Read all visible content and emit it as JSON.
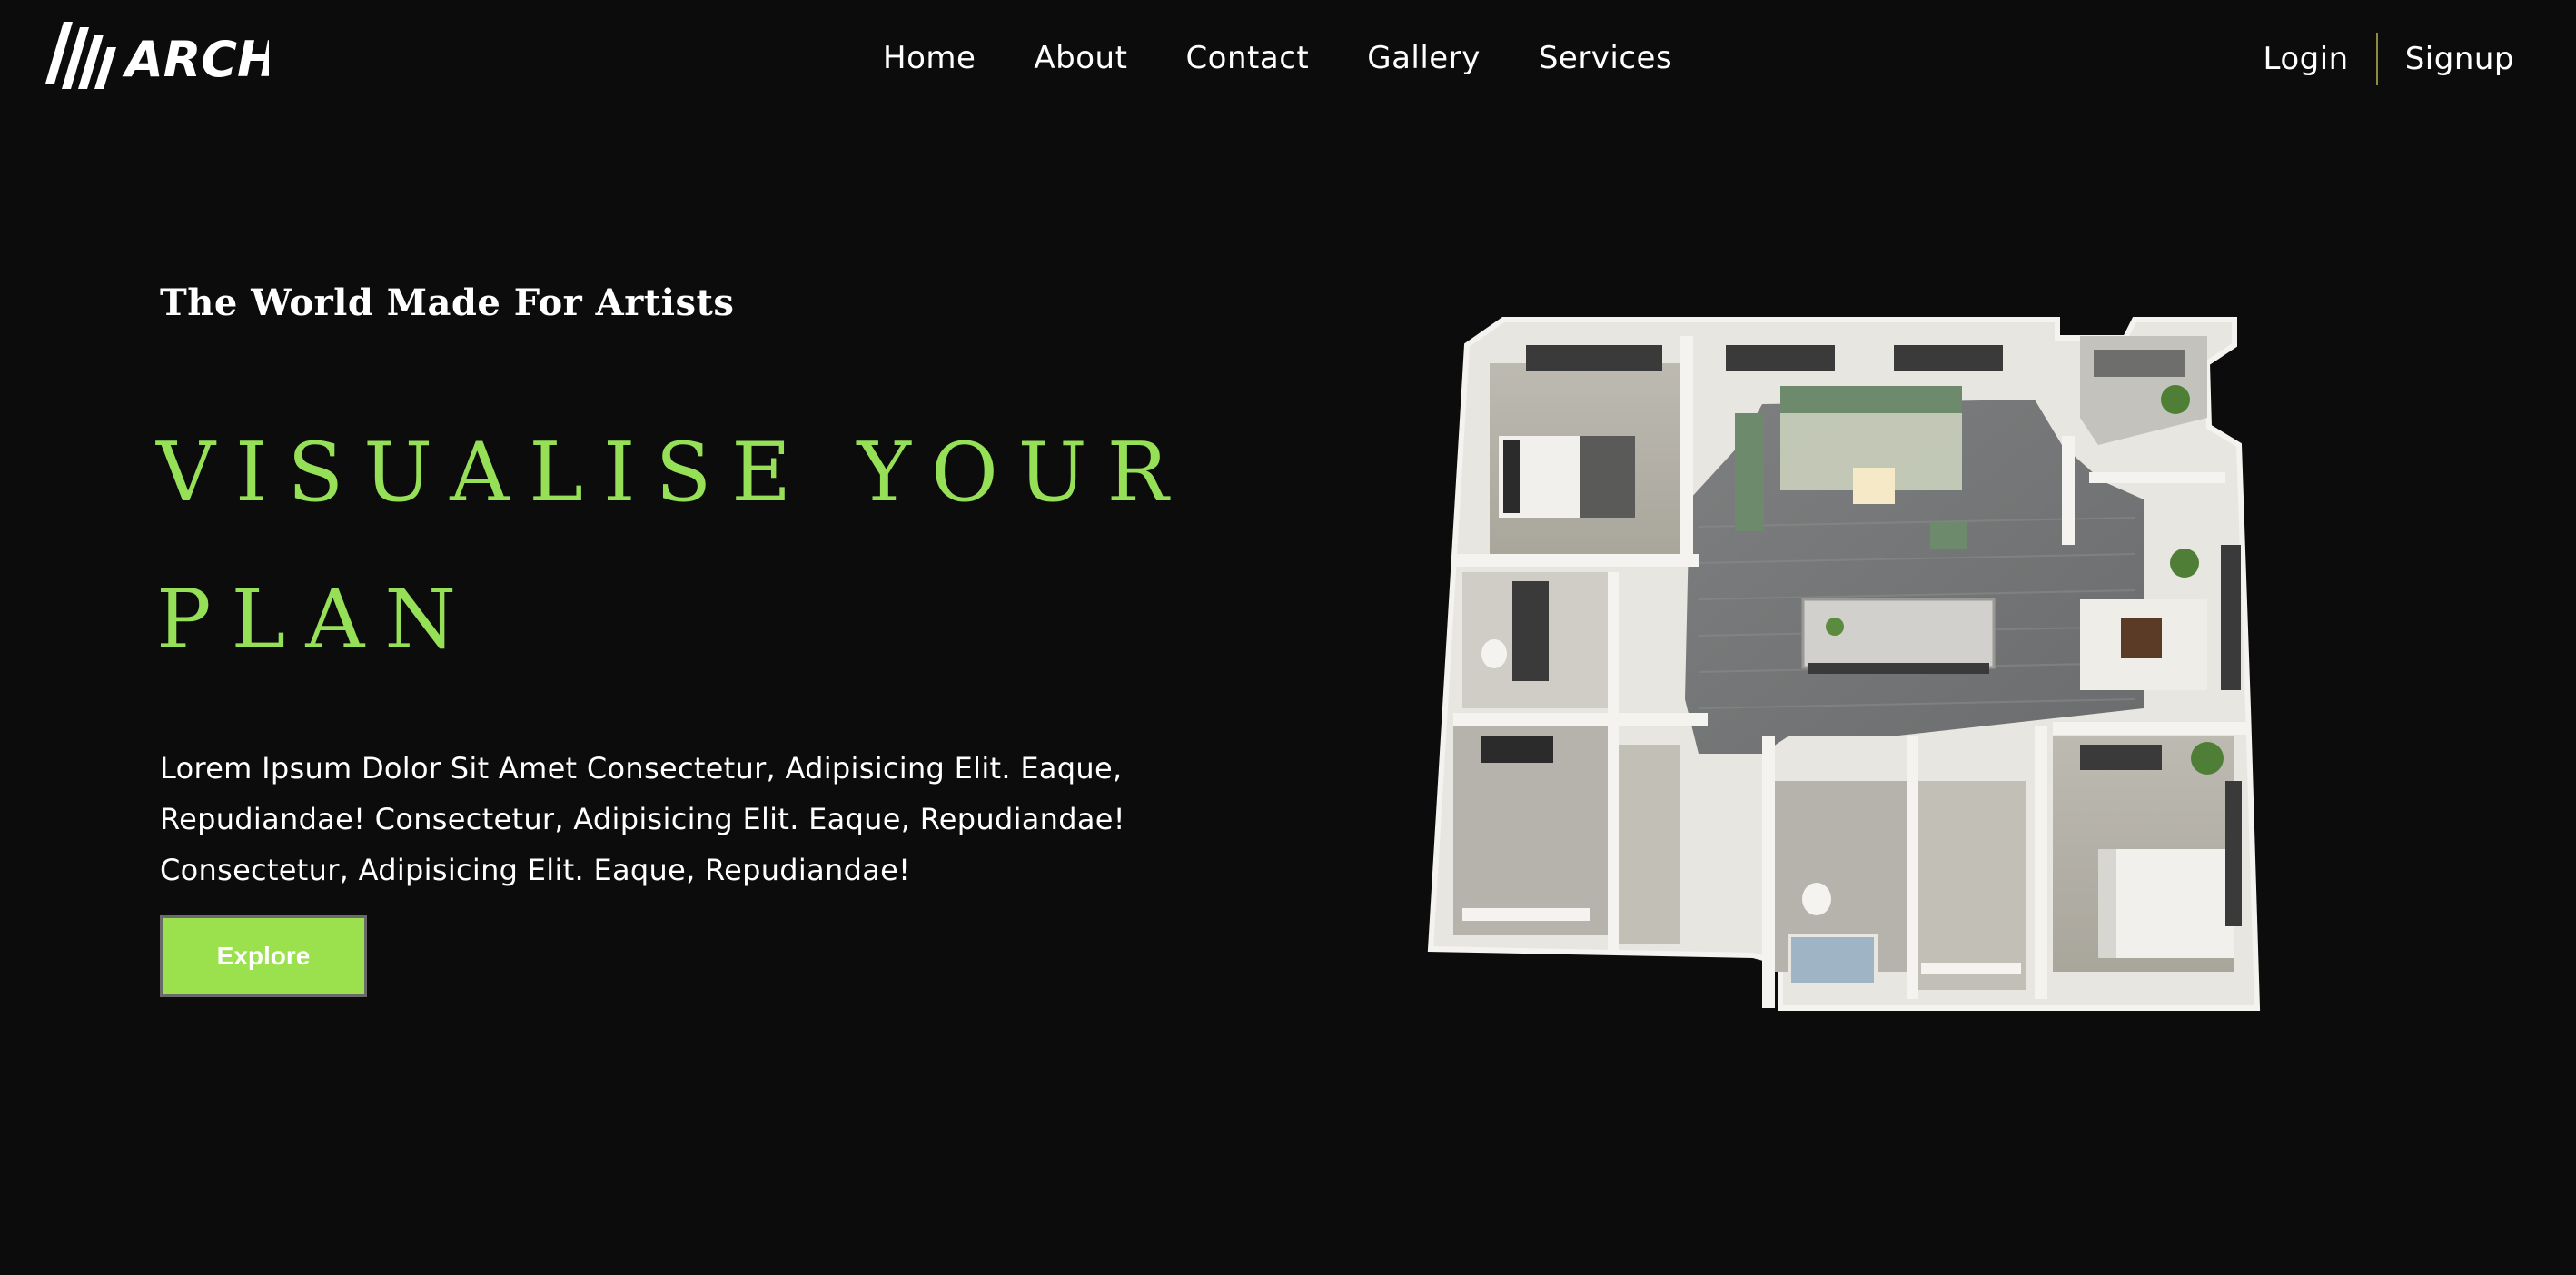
{
  "brand": {
    "logo_text": "ARCH"
  },
  "nav": {
    "items": [
      {
        "label": "Home"
      },
      {
        "label": "About"
      },
      {
        "label": "Contact"
      },
      {
        "label": "Gallery"
      },
      {
        "label": "Services"
      }
    ]
  },
  "auth": {
    "login_label": "Login",
    "signup_label": "Signup"
  },
  "hero": {
    "tagline": "The World Made For Artists",
    "headline_line1": "VISUALISE YOUR",
    "headline_line2": "PLAN",
    "description": "Lorem Ipsum Dolor Sit Amet Consectetur, Adipisicing Elit. Eaque, Repudiandae! Consectetur, Adipisicing Elit. Eaque, Repudiandae! Consectetur, Adipisicing Elit. Eaque, Repudiandae!",
    "cta_label": "Explore"
  },
  "colors": {
    "background": "#0c0c0c",
    "accent": "#95e057",
    "button": "#9be14e",
    "divider": "#8f8a3c"
  },
  "icons": {
    "logo": "arch-logo-icon"
  }
}
